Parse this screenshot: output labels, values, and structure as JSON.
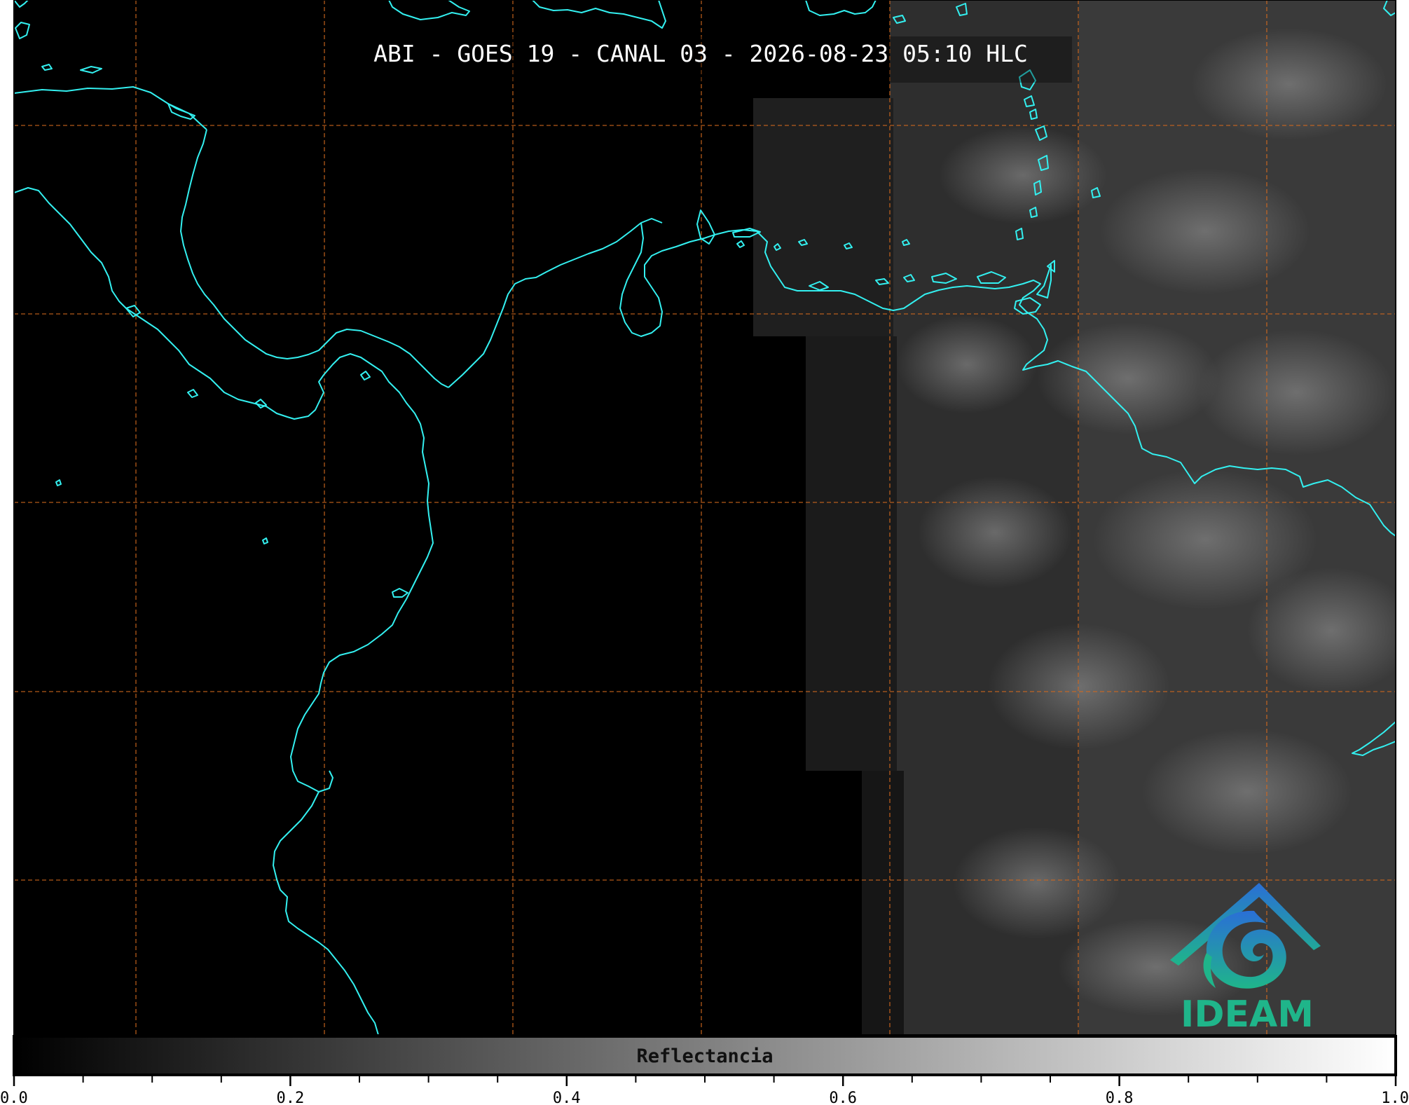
{
  "map": {
    "title": "ABI - GOES 19 - CANAL 03 - 2026-08-23 05:10 HLC",
    "background": "#000000",
    "coastline_color": "#33f0f0",
    "grid_color": "#d2691e",
    "cloud_color": "#6a6a6a"
  },
  "colorbar": {
    "label": "Reflectancia",
    "min": 0.0,
    "max": 1.0,
    "tick_labels": [
      "0.0",
      "0.2",
      "0.4",
      "0.6",
      "0.8",
      "1.0"
    ],
    "gradient_from": "#000000",
    "gradient_to": "#ffffff"
  },
  "logo": {
    "text": "IDEAM",
    "icon": "ideam-logo-icon",
    "color_top": "#2a6fd6",
    "color_bottom": "#1fb58a"
  }
}
